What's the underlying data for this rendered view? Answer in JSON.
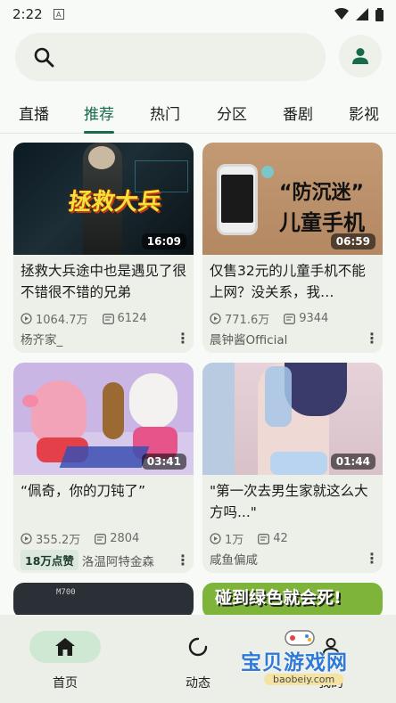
{
  "status_bar": {
    "time": "2:22",
    "app_indicator": "A"
  },
  "search": {
    "placeholder": ""
  },
  "tabs": [
    {
      "label": "直播"
    },
    {
      "label": "推荐",
      "active": true
    },
    {
      "label": "热门"
    },
    {
      "label": "分区"
    },
    {
      "label": "番剧"
    },
    {
      "label": "影视"
    }
  ],
  "cards": [
    {
      "thumb_text": "拯救大兵",
      "duration": "16:09",
      "title": "拯救大兵途中也是遇见了很不错很不错的兄弟",
      "views": "1064.7万",
      "danmaku": "6124",
      "author": "杨齐家_"
    },
    {
      "thumb_text_1": "“防沉迷”",
      "thumb_text_2": "儿童手机",
      "duration": "06:59",
      "title": "仅售32元的儿童手机不能上网？没关系，我…",
      "views": "771.6万",
      "danmaku": "9344",
      "author": "晨钟酱Official"
    },
    {
      "duration": "03:41",
      "title": "“佩奇，你的刀钝了”",
      "views": "355.2万",
      "danmaku": "2804",
      "badge": "18万点赞",
      "author": "洛温阿特金森"
    },
    {
      "duration": "01:44",
      "title": "\"第一次去男生家就这么大方吗...\"",
      "views": "1万",
      "danmaku": "42",
      "author": "咸鱼偏咸"
    }
  ],
  "partial_cards": [
    {
      "thumb_text": "M700"
    },
    {
      "thumb_text": "碰到绿色就会死!"
    }
  ],
  "bottom_nav": [
    {
      "label": "首页",
      "icon": "home-icon",
      "active": true
    },
    {
      "label": "动态",
      "icon": "refresh-icon"
    },
    {
      "label": "我的",
      "icon": "person-icon"
    }
  ],
  "watermark": {
    "text": "宝贝游戏网",
    "sub": "baobeiy.com"
  },
  "colors": {
    "accent": "#176b48",
    "card_bg": "#edefe9",
    "page_bg": "#f8faf7"
  }
}
